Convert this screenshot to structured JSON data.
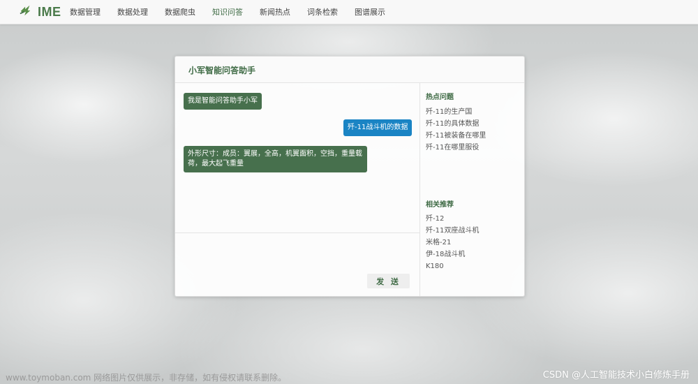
{
  "brand": {
    "name": "IME",
    "logo_icon": "leaf-logo-icon",
    "color": "#4a7a4a"
  },
  "nav": {
    "items": [
      {
        "label": "数据管理"
      },
      {
        "label": "数据处理"
      },
      {
        "label": "数据爬虫"
      },
      {
        "label": "知识问答",
        "active": true
      },
      {
        "label": "新闻热点"
      },
      {
        "label": "词条检索"
      },
      {
        "label": "图谱展示"
      }
    ]
  },
  "panel": {
    "title": "小军智能问答助手"
  },
  "chat": {
    "messages": [
      {
        "role": "bot",
        "text": "我是智能问答助手小军"
      },
      {
        "role": "user",
        "text": "歼-11战斗机的数据"
      },
      {
        "role": "bot",
        "text": "外形尺寸：成员：翼展，全高，机翼面积，空挡，重量载荷，最大起飞重量"
      }
    ],
    "send_label": "发 送"
  },
  "sidebar": {
    "hot_title": "热点问题",
    "hot": [
      "歼-11的生产国",
      "歼-11的具体数据",
      "歼-11被装备在哪里",
      "歼-11在哪里服役"
    ],
    "related_title": "相关推荐",
    "related": [
      "歼-12",
      "歼-11双座战斗机",
      "米格-21",
      "伊-18战斗机",
      "K180"
    ]
  },
  "watermarks": {
    "left": "www.toymoban.com 网络图片仅供展示，非存储，如有侵权请联系删除。",
    "right": "CSDN @人工智能技术小白修炼手册"
  },
  "colors": {
    "accent_green": "#3f6b45",
    "bot_bubble": "#47704d",
    "user_bubble": "#1a84c4"
  }
}
